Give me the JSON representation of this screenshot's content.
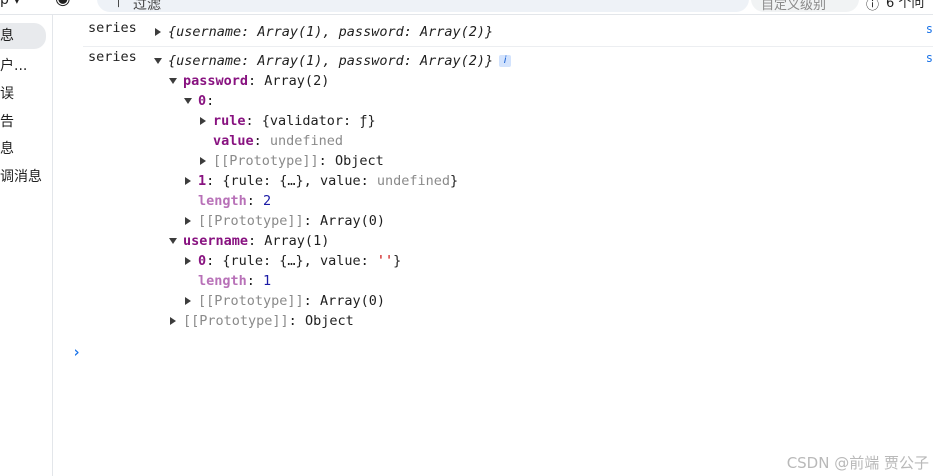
{
  "toolbar": {
    "context_label": "p",
    "filter_placeholder": "过滤",
    "level_select": "自定义级别",
    "issue_count": "6 个问"
  },
  "sidebar": {
    "items": [
      {
        "label": "息"
      },
      {
        "label": "户..."
      },
      {
        "label": "误"
      },
      {
        "label": "告"
      },
      {
        "label": "息"
      },
      {
        "label": "调消息"
      }
    ]
  },
  "console": {
    "entry1": {
      "label": "series",
      "summary": "{username: Array(1), password: Array(2)}",
      "source": "s"
    },
    "entry2": {
      "label": "series",
      "summary": "{username: Array(1), password: Array(2)}",
      "info_badge": "i",
      "source": "s",
      "password_key": "password",
      "password_val": "Array(2)",
      "p0_key": "0",
      "rule_key": "rule",
      "rule_val": "{validator: ƒ}",
      "value_key": "value",
      "value_val": "undefined",
      "proto_key": "[[Prototype]]",
      "proto_object": "Object",
      "p1_key": "1",
      "p1_val_a": "{rule: {…}, value: ",
      "p1_val_b": "undefined",
      "p1_val_c": "}",
      "length_key": "length",
      "password_length": "2",
      "proto_array": "Array(0)",
      "username_key": "username",
      "username_val": "Array(1)",
      "u0_key": "0",
      "u0_val_a": "{rule: {…}, value: ",
      "u0_val_b": "''",
      "u0_val_c": "}",
      "username_length": "1"
    },
    "prompt": "›"
  },
  "watermark": "CSDN @前端 贾公子"
}
